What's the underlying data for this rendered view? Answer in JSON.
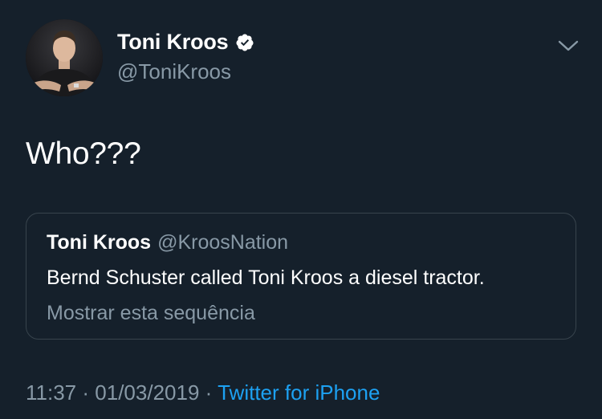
{
  "author": {
    "display_name": "Toni Kroos",
    "handle": "@ToniKroos",
    "verified": true,
    "avatar_icon": "profile-photo"
  },
  "tweet": {
    "text": "Who???"
  },
  "quoted_tweet": {
    "display_name": "Toni Kroos",
    "handle": "@KroosNation",
    "text": "Bernd Schuster called Toni Kroos a diesel tractor.",
    "show_thread_label": "Mostrar esta sequência"
  },
  "meta": {
    "time": "11:37",
    "date": "01/03/2019",
    "separator": "·",
    "source": "Twitter for iPhone"
  },
  "icons": {
    "verified": "verified-badge-icon",
    "menu": "chevron-down-icon"
  },
  "colors": {
    "background": "#15202b",
    "secondary_text": "#8899a6",
    "accent": "#1da1f2",
    "border": "#38444d"
  }
}
